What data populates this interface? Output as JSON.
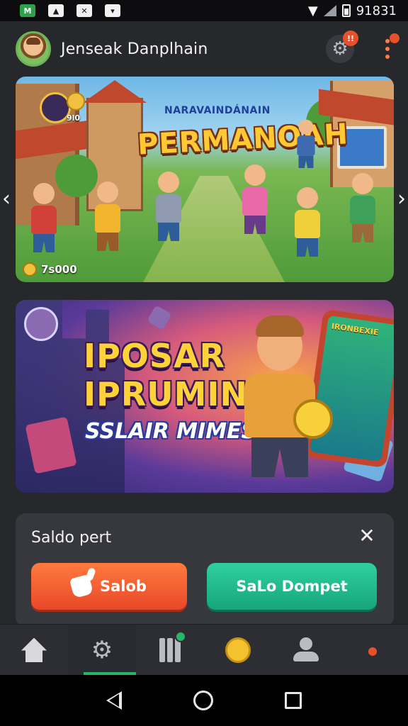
{
  "status_bar": {
    "time": "91831",
    "notification_icons": [
      "mail-icon",
      "image-icon",
      "tool-icon",
      "message-icon"
    ],
    "system_icons": [
      "wifi-icon",
      "signal-icon",
      "battery-icon"
    ]
  },
  "header": {
    "title": "Jenseak Danplhain",
    "notification_badge": "!!",
    "avatar_icon": "avatar"
  },
  "banners": [
    {
      "subtitle": "NARAVAINDÁNAIN",
      "title": "PERMANOAH",
      "counter": "7s000",
      "small_label": "9l0"
    },
    {
      "title_line1": "IPOSAR",
      "title_line2": "IPRUMIN",
      "subtitle": "SSLAIR MIMESI",
      "phone_label": "IRONBEXIE"
    }
  ],
  "carousel": {
    "prev_icon": "chevron-left-icon",
    "next_icon": "chevron-right-icon"
  },
  "balance_panel": {
    "title": "Saldo pert",
    "close_icon": "close-icon",
    "primary_button": "Salob",
    "secondary_button": "SaLo Dompet"
  },
  "bottom_nav": {
    "items": [
      {
        "icon": "home-icon"
      },
      {
        "icon": "gear-icon"
      },
      {
        "icon": "book-icon"
      },
      {
        "icon": "coin-icon"
      },
      {
        "icon": "profile-icon"
      },
      {
        "icon": "bird-icon"
      }
    ],
    "active_index": 1
  },
  "colors": {
    "background": "#27282c",
    "accent_green": "#25b56b",
    "button_orange": "#e8482a",
    "button_teal": "#17a57d",
    "badge_red": "#e8502c"
  }
}
